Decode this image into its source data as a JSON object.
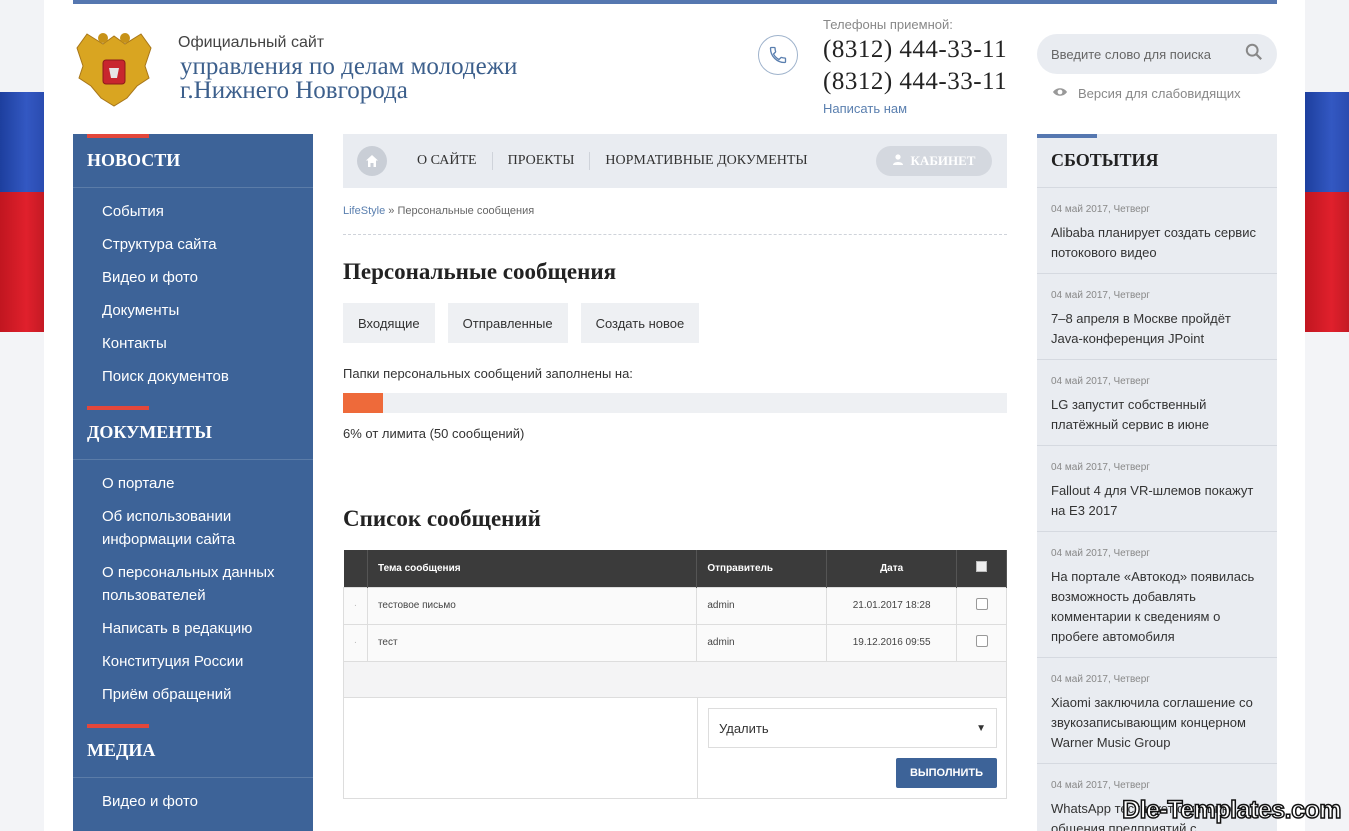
{
  "header": {
    "pre_title": "Официальный сайт",
    "name_line1": "управления по делам молодежи",
    "name_line2": "г.Нижнего Новгорода",
    "phones_label": "Телефоны приемной:",
    "phone1": "(8312) 444-33-11",
    "phone2": "(8312) 444-33-11",
    "write_us": "Написать нам",
    "search_placeholder": "Введите слово для поиска",
    "low_vision": "Версия для слабовидящих"
  },
  "sidebar": {
    "sections": [
      {
        "title": "НОВОСТИ",
        "items": [
          "События",
          "Структура сайта",
          "Видео и фото",
          "Документы",
          "Контакты",
          "Поиск документов"
        ]
      },
      {
        "title": "ДОКУМЕНТЫ",
        "items": [
          "О портале",
          "Об использовании информации сайта",
          "О персональных данных пользователей",
          "Написать в редакцию",
          "Конституция России",
          "Приём обращений"
        ]
      },
      {
        "title": "МЕДИА",
        "items": [
          "Видео и фото"
        ]
      }
    ]
  },
  "nav": {
    "items": [
      "О САЙТЕ",
      "ПРОЕКТЫ",
      "НОРМАТИВНЫЕ ДОКУМЕНТЫ"
    ],
    "cabinet": "КАБИНЕТ"
  },
  "breadcrumb": {
    "link": "LifeStyle",
    "sep": " » ",
    "current": "Персональные сообщения"
  },
  "pm": {
    "title": "Персональные сообщения",
    "tabs": [
      "Входящие",
      "Отправленные",
      "Создать новое"
    ],
    "fill_label": "Папки персональных сообщений заполнены на:",
    "fill_percent": 6,
    "limit_text": "6% от лимита (50 сообщений)"
  },
  "list": {
    "title": "Список сообщений",
    "columns": [
      "Тема сообщения",
      "Отправитель",
      "Дата"
    ],
    "rows": [
      {
        "subject": "тестовое письмо",
        "sender": "admin",
        "date": "21.01.2017 18:28"
      },
      {
        "subject": "тест",
        "sender": "admin",
        "date": "19.12.2016 09:55"
      }
    ],
    "action_selected": "Удалить",
    "execute": "ВЫПОЛНИТЬ"
  },
  "events": {
    "title": "СБОТЫТИЯ",
    "items": [
      {
        "date": "04 май 2017, Четверг",
        "text": "Alibaba планирует создать сервис потокового видео"
      },
      {
        "date": "04 май 2017, Четверг",
        "text": "7–8 апреля в Москве пройдёт Java-конференция JPoint"
      },
      {
        "date": "04 май 2017, Четверг",
        "text": "LG запустит собственный платёжный сервис в июне"
      },
      {
        "date": "04 май 2017, Четверг",
        "text": "Fallout 4 для VR-шлемов покажут на E3 2017"
      },
      {
        "date": "04 май 2017, Четверг",
        "text": "На портале «Автокод» появилась возможность добавлять комментарии к сведениям о пробеге автомобиля"
      },
      {
        "date": "04 май 2017, Четверг",
        "text": "Xiaomi заключила соглашение со звукозаписывающим концерном Warner Music Group"
      },
      {
        "date": "04 май 2017, Четверг",
        "text": "WhatsApp тестирует функцию общения предприятий с клиентами"
      }
    ]
  },
  "watermark": "Dle-Templates.com",
  "colors": {
    "accent_blue": "#3d6398",
    "accent_red": "#e3473b",
    "progress": "#ee6a3a"
  }
}
